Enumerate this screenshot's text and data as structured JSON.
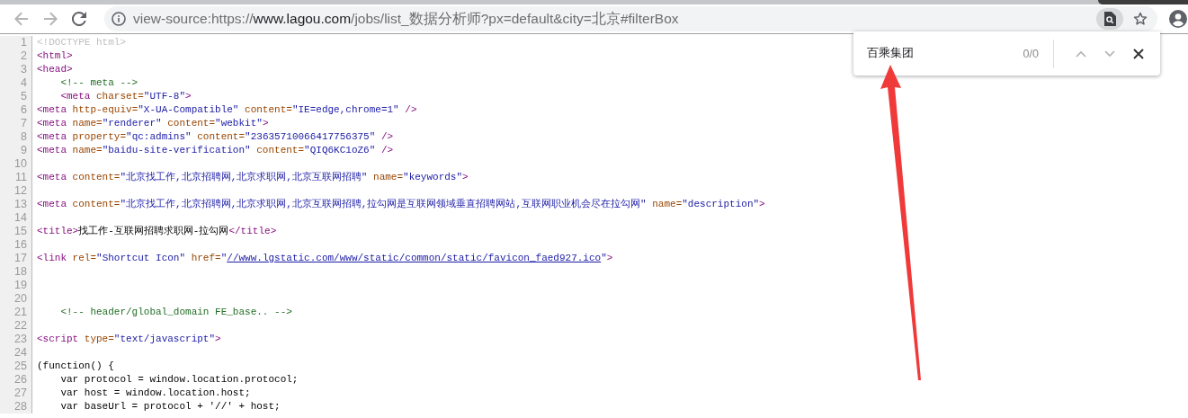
{
  "toolbar": {
    "url": {
      "scheme": "view-source:https://",
      "host": "www.lagou.com",
      "path": "/jobs/list_数据分析师?px=default&city=北京#filterBox"
    },
    "find_in_page_active": true
  },
  "find_bar": {
    "query": "百乘集团",
    "count": "0/0"
  },
  "source": {
    "lines": [
      {
        "number": "1",
        "tokens": [
          {
            "kind": "doctype",
            "text": "<!DOCTYPE html>"
          }
        ]
      },
      {
        "number": "2",
        "tokens": [
          {
            "kind": "tag",
            "text": "<html>"
          }
        ]
      },
      {
        "number": "3",
        "tokens": [
          {
            "kind": "tag",
            "text": "<head>"
          }
        ]
      },
      {
        "number": "4",
        "tokens": [
          {
            "kind": "comment",
            "text": "    <!-- meta -->"
          }
        ]
      },
      {
        "number": "5",
        "tokens": [
          {
            "kind": "tag",
            "text": "    <meta"
          },
          {
            "kind": "attr",
            "text": " charset="
          },
          {
            "kind": "value",
            "text": "\"UTF-8\""
          },
          {
            "kind": "tag",
            "text": ">"
          }
        ]
      },
      {
        "number": "6",
        "tokens": [
          {
            "kind": "tag",
            "text": "<meta"
          },
          {
            "kind": "attr",
            "text": " http-equiv="
          },
          {
            "kind": "value",
            "text": "\"X-UA-Compatible\""
          },
          {
            "kind": "attr",
            "text": " content="
          },
          {
            "kind": "value",
            "text": "\"IE=edge,chrome=1\""
          },
          {
            "kind": "tag",
            "text": " />"
          }
        ]
      },
      {
        "number": "7",
        "tokens": [
          {
            "kind": "tag",
            "text": "<meta"
          },
          {
            "kind": "attr",
            "text": " name="
          },
          {
            "kind": "value",
            "text": "\"renderer\""
          },
          {
            "kind": "attr",
            "text": " content="
          },
          {
            "kind": "value",
            "text": "\"webkit\""
          },
          {
            "kind": "tag",
            "text": ">"
          }
        ]
      },
      {
        "number": "8",
        "tokens": [
          {
            "kind": "tag",
            "text": "<meta"
          },
          {
            "kind": "attr",
            "text": " property="
          },
          {
            "kind": "value",
            "text": "\"qc:admins\""
          },
          {
            "kind": "attr",
            "text": " content="
          },
          {
            "kind": "value",
            "text": "\"23635710066417756375\""
          },
          {
            "kind": "tag",
            "text": " />"
          }
        ]
      },
      {
        "number": "9",
        "tokens": [
          {
            "kind": "tag",
            "text": "<meta"
          },
          {
            "kind": "attr",
            "text": " name="
          },
          {
            "kind": "value",
            "text": "\"baidu-site-verification\""
          },
          {
            "kind": "attr",
            "text": " content="
          },
          {
            "kind": "value",
            "text": "\"QIQ6KC1oZ6\""
          },
          {
            "kind": "tag",
            "text": " />"
          }
        ]
      },
      {
        "number": "10"
      },
      {
        "number": "11",
        "tokens": [
          {
            "kind": "tag",
            "text": "<meta"
          },
          {
            "kind": "attr",
            "text": " content="
          },
          {
            "kind": "value",
            "text": "\"北京找工作,北京招聘网,北京求职网,北京互联网招聘\""
          },
          {
            "kind": "attr",
            "text": " name="
          },
          {
            "kind": "value",
            "text": "\"keywords\""
          },
          {
            "kind": "tag",
            "text": ">"
          }
        ]
      },
      {
        "number": "12"
      },
      {
        "number": "13",
        "tokens": [
          {
            "kind": "tag",
            "text": "<meta"
          },
          {
            "kind": "attr",
            "text": " content="
          },
          {
            "kind": "value",
            "text": "\"北京找工作,北京招聘网,北京求职网,北京互联网招聘,拉勾网是互联网领域垂直招聘网站,互联网职业机会尽在拉勾网\""
          },
          {
            "kind": "attr",
            "text": " name="
          },
          {
            "kind": "value",
            "text": "\"description\""
          },
          {
            "kind": "tag",
            "text": ">"
          }
        ]
      },
      {
        "number": "14"
      },
      {
        "number": "15",
        "tokens": [
          {
            "kind": "tag",
            "text": "<title>"
          },
          {
            "kind": "text",
            "text": "找工作-互联网招聘求职网-拉勾网"
          },
          {
            "kind": "tag",
            "text": "</title>"
          }
        ]
      },
      {
        "number": "16"
      },
      {
        "number": "17",
        "tokens": [
          {
            "kind": "tag",
            "text": "<link"
          },
          {
            "kind": "attr",
            "text": " rel="
          },
          {
            "kind": "value",
            "text": "\"Shortcut Icon\""
          },
          {
            "kind": "attr",
            "text": " href="
          },
          {
            "kind": "value",
            "text": "\""
          },
          {
            "kind": "link",
            "text": "//www.lgstatic.com/www/static/common/static/favicon_faed927.ico"
          },
          {
            "kind": "value",
            "text": "\""
          },
          {
            "kind": "tag",
            "text": ">"
          }
        ]
      },
      {
        "number": "18"
      },
      {
        "number": "19"
      },
      {
        "number": "20"
      },
      {
        "number": "21",
        "tokens": [
          {
            "kind": "comment",
            "text": "    <!-- header/global_domain FE_base.. -->"
          }
        ]
      },
      {
        "number": "22"
      },
      {
        "number": "23",
        "tokens": [
          {
            "kind": "tag",
            "text": "<script"
          },
          {
            "kind": "attr",
            "text": " type="
          },
          {
            "kind": "value",
            "text": "\"text/javascript\""
          },
          {
            "kind": "tag",
            "text": ">"
          }
        ]
      },
      {
        "number": "24"
      },
      {
        "number": "25",
        "tokens": [
          {
            "kind": "text",
            "text": "(function() {"
          }
        ]
      },
      {
        "number": "26",
        "tokens": [
          {
            "kind": "text",
            "text": "    var protocol = window.location.protocol;"
          }
        ]
      },
      {
        "number": "27",
        "tokens": [
          {
            "kind": "text",
            "text": "    var host = window.location.host;"
          }
        ]
      },
      {
        "number": "28",
        "tokens": [
          {
            "kind": "text",
            "text": "    var baseUrl = protocol + '//' + host;"
          }
        ]
      }
    ]
  }
}
